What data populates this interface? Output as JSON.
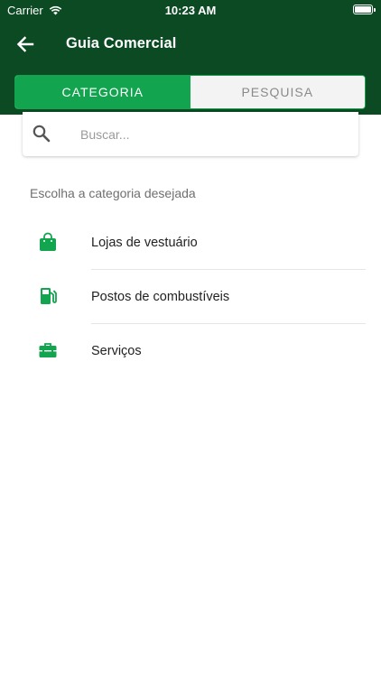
{
  "status_bar": {
    "carrier": "Carrier",
    "time": "10:23 AM"
  },
  "header": {
    "title": "Guia Comercial",
    "back_icon": "arrow-left-icon"
  },
  "tabs": [
    {
      "label": "CATEGORIA",
      "active": true
    },
    {
      "label": "PESQUISA",
      "active": false
    }
  ],
  "search": {
    "placeholder": "Buscar...",
    "value": ""
  },
  "section_label": "Escolha a categoria desejada",
  "categories": [
    {
      "label": "Lojas de vestuário",
      "icon": "shopping-bag-icon"
    },
    {
      "label": "Postos de combustíveis",
      "icon": "gas-station-icon"
    },
    {
      "label": "Serviços",
      "icon": "toolbox-icon"
    }
  ],
  "colors": {
    "header": "#0b4a23",
    "accent": "#12a44e"
  }
}
